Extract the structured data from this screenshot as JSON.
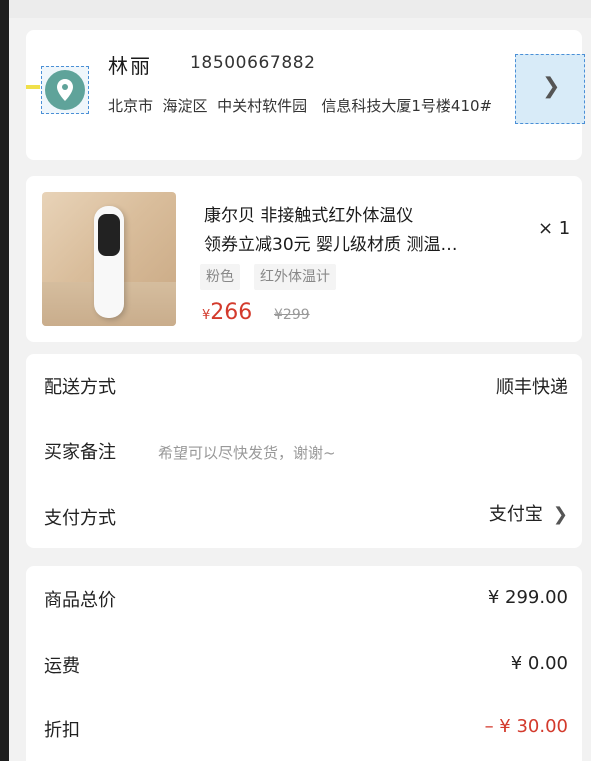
{
  "address": {
    "name": "林丽",
    "phone": "18500667882",
    "address_line": "北京市  海淀区  中关村软件园   信息科技大厦1号楼410#",
    "icon": "location-pin-icon",
    "arrow_icon": "chevron-right-icon"
  },
  "product": {
    "title_line1": "康尔贝 非接触式红外体温仪",
    "title_line2": "领券立减30元 婴儿级材质 测温…",
    "quantity": "× 1",
    "tags": [
      "粉色",
      "红外体温计"
    ],
    "price_symbol": "¥",
    "price": "266",
    "original_price": "¥299"
  },
  "order_info": {
    "delivery_label": "配送方式",
    "delivery_value": "顺丰快递",
    "remark_label": "买家备注",
    "remark_placeholder": "希望可以尽快发货，谢谢~",
    "payment_label": "支付方式",
    "payment_value": "支付宝"
  },
  "costs": {
    "total_label": "商品总价",
    "total_value": "¥ 299.00",
    "shipping_label": "运费",
    "shipping_value": "¥ 0.00",
    "discount_label": "折扣",
    "discount_value": "– ¥ 30.00"
  },
  "colors": {
    "accent_red": "#d33a2c",
    "location_icon": "#5fa39a"
  }
}
